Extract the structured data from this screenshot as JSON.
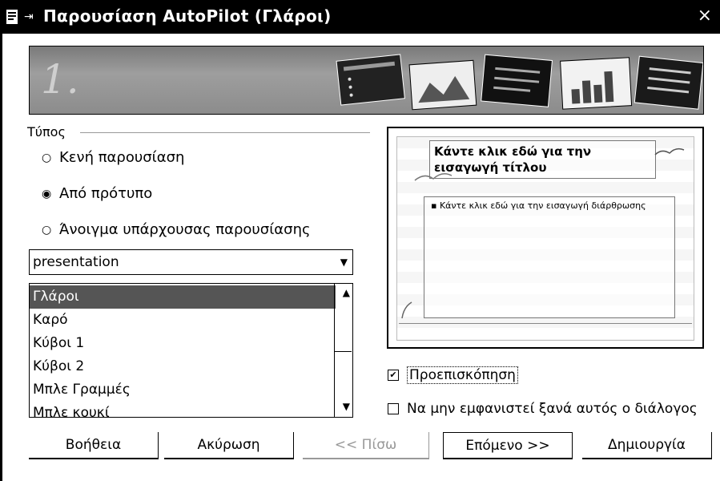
{
  "window": {
    "title": "Παρουσίαση AutoPilot (Γλάροι)",
    "close_glyph": "×",
    "pin_glyph": "⇥"
  },
  "banner": {
    "step": "1."
  },
  "type_group": {
    "label": "Τύπος",
    "options": [
      {
        "label": "Κενή παρουσίαση",
        "selected": false
      },
      {
        "label": "Από πρότυπο",
        "selected": true
      },
      {
        "label": "Άνοιγμα υπάρχουσας παρουσίασης",
        "selected": false
      }
    ]
  },
  "category_select": {
    "value": "presentation"
  },
  "template_list": {
    "items": [
      "Γλάροι",
      "Καρό",
      "Κύβοι 1",
      "Κύβοι 2",
      "Μπλε Γραμμές",
      "Μπλε κουκί"
    ],
    "selected": "Γλάροι"
  },
  "preview": {
    "title_text": "Κάντε κλικ εδώ για την εισαγωγή τίτλου",
    "body_text": "Κάντε κλικ εδώ για την εισαγωγή διάρθρωσης"
  },
  "options": {
    "preview": {
      "label": "Προεπισκόπηση",
      "checked": true
    },
    "dont_show": {
      "label": "Να μην εμφανιστεί ξανά αυτός ο διάλογος",
      "checked": false
    }
  },
  "buttons": {
    "help": "Βοήθεια",
    "cancel": "Ακύρωση",
    "back": "<< Πίσω",
    "next": "Επόμενο >>",
    "create": "Δημιουργία"
  }
}
